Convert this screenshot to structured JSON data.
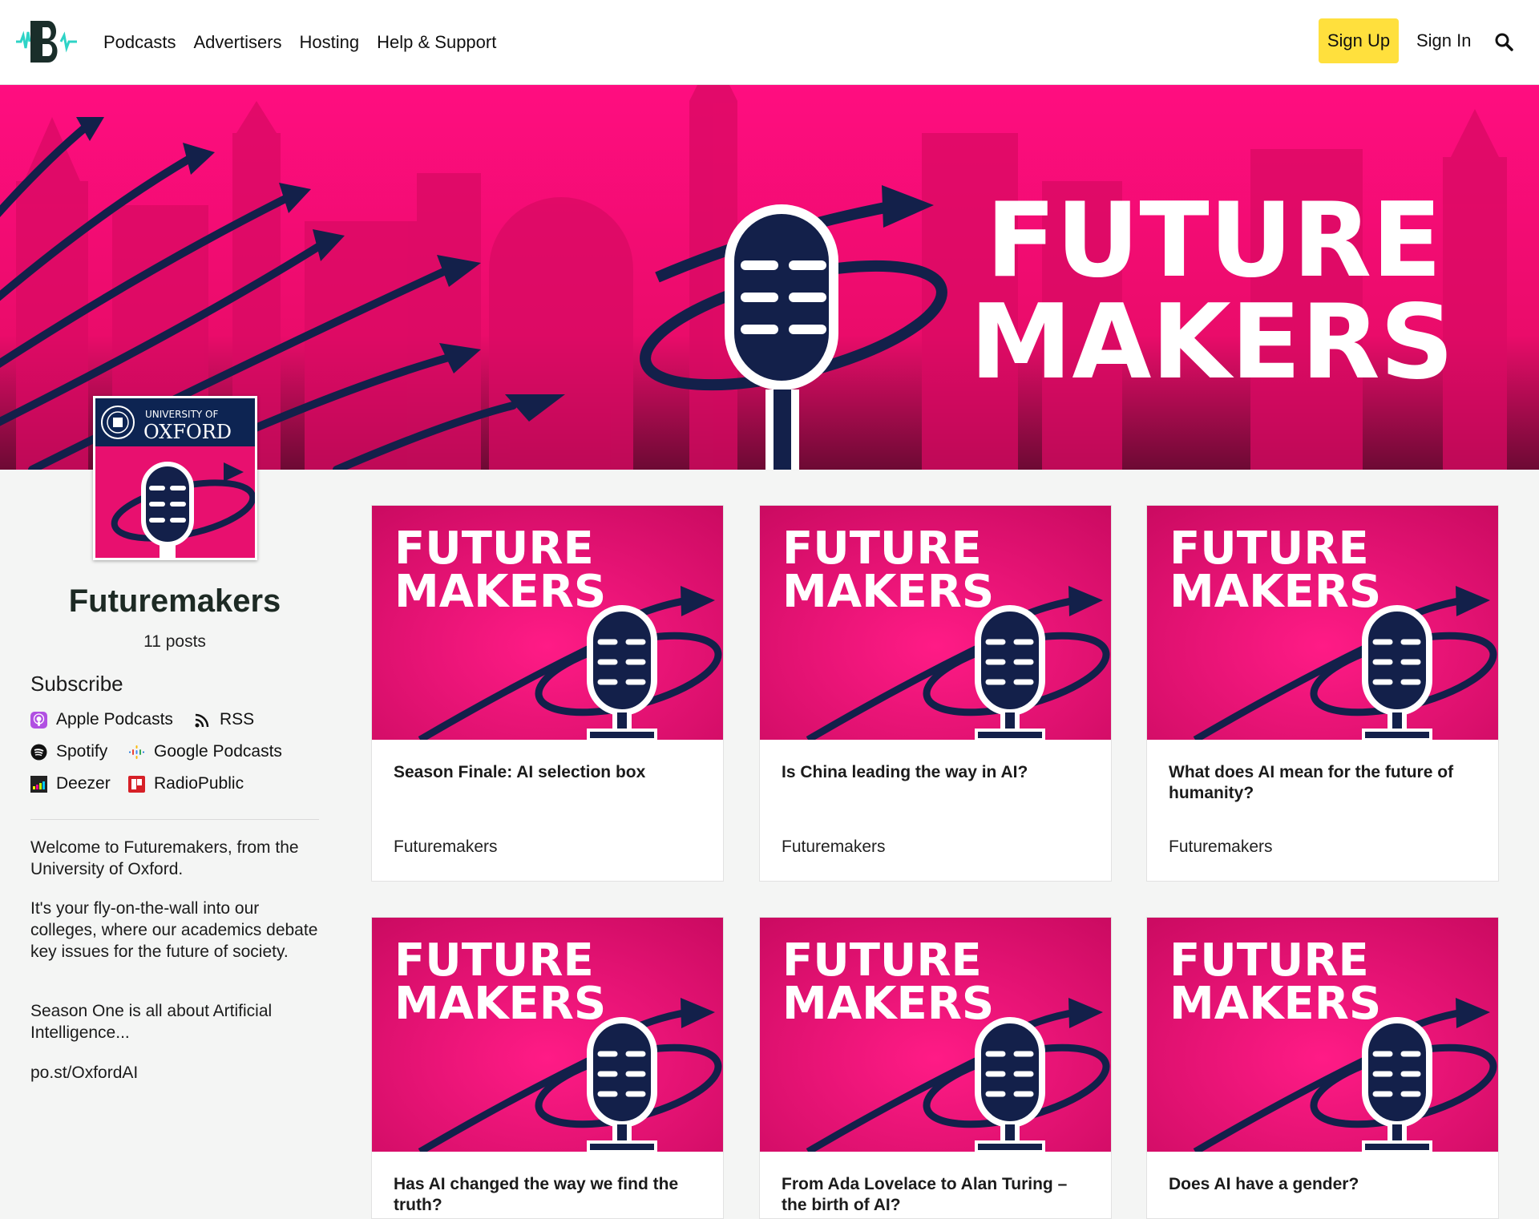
{
  "nav": {
    "links": [
      "Podcasts",
      "Advertisers",
      "Hosting",
      "Help & Support"
    ],
    "signup_label": "Sign Up",
    "signin_label": "Sign In",
    "accent_color": "#ffe03d",
    "logo_icon": "podbean-b-logo",
    "search_icon": "search-icon"
  },
  "hero": {
    "title_line1": "FUTURE",
    "title_line2": "MAKERS",
    "bg_color": "#ff0a7a"
  },
  "cover": {
    "line1": "UNIVERSITY OF",
    "line2": "OXFORD"
  },
  "show": {
    "title": "Futuremakers",
    "posts": "11 posts"
  },
  "subscribe": {
    "heading": "Subscribe",
    "items": [
      {
        "label": "Apple Podcasts",
        "icon": "apple-podcasts-icon"
      },
      {
        "label": "RSS",
        "icon": "rss-icon"
      },
      {
        "label": "Spotify",
        "icon": "spotify-icon"
      },
      {
        "label": "Google Podcasts",
        "icon": "google-podcasts-icon"
      },
      {
        "label": "Deezer",
        "icon": "deezer-icon"
      },
      {
        "label": "RadioPublic",
        "icon": "radiopublic-icon"
      }
    ]
  },
  "description": [
    "Welcome to Futuremakers, from the University of Oxford.",
    "It's your fly-on-the-wall into our colleges, where our academics debate key issues for the future of society.",
    "Season One is all about Artificial Intelligence...",
    "po.st/OxfordAI"
  ],
  "episodes": [
    {
      "title": "Season Finale: AI selection box",
      "show": "Futuremakers",
      "art_line1": "FUTURE",
      "art_line2": "MAKERS"
    },
    {
      "title": "Is China leading the way in AI?",
      "show": "Futuremakers",
      "art_line1": "FUTURE",
      "art_line2": "MAKERS"
    },
    {
      "title": "What does AI mean for the future of humanity?",
      "show": "Futuremakers",
      "art_line1": "FUTURE",
      "art_line2": "MAKERS"
    },
    {
      "title": "Has AI changed the way we find the truth?",
      "show": "",
      "art_line1": "FUTURE",
      "art_line2": "MAKERS"
    },
    {
      "title": "From Ada Lovelace to Alan Turing – the birth of AI?",
      "show": "",
      "art_line1": "FUTURE",
      "art_line2": "MAKERS"
    },
    {
      "title": "Does AI have a gender?",
      "show": "",
      "art_line1": "FUTURE",
      "art_line2": "MAKERS"
    }
  ]
}
